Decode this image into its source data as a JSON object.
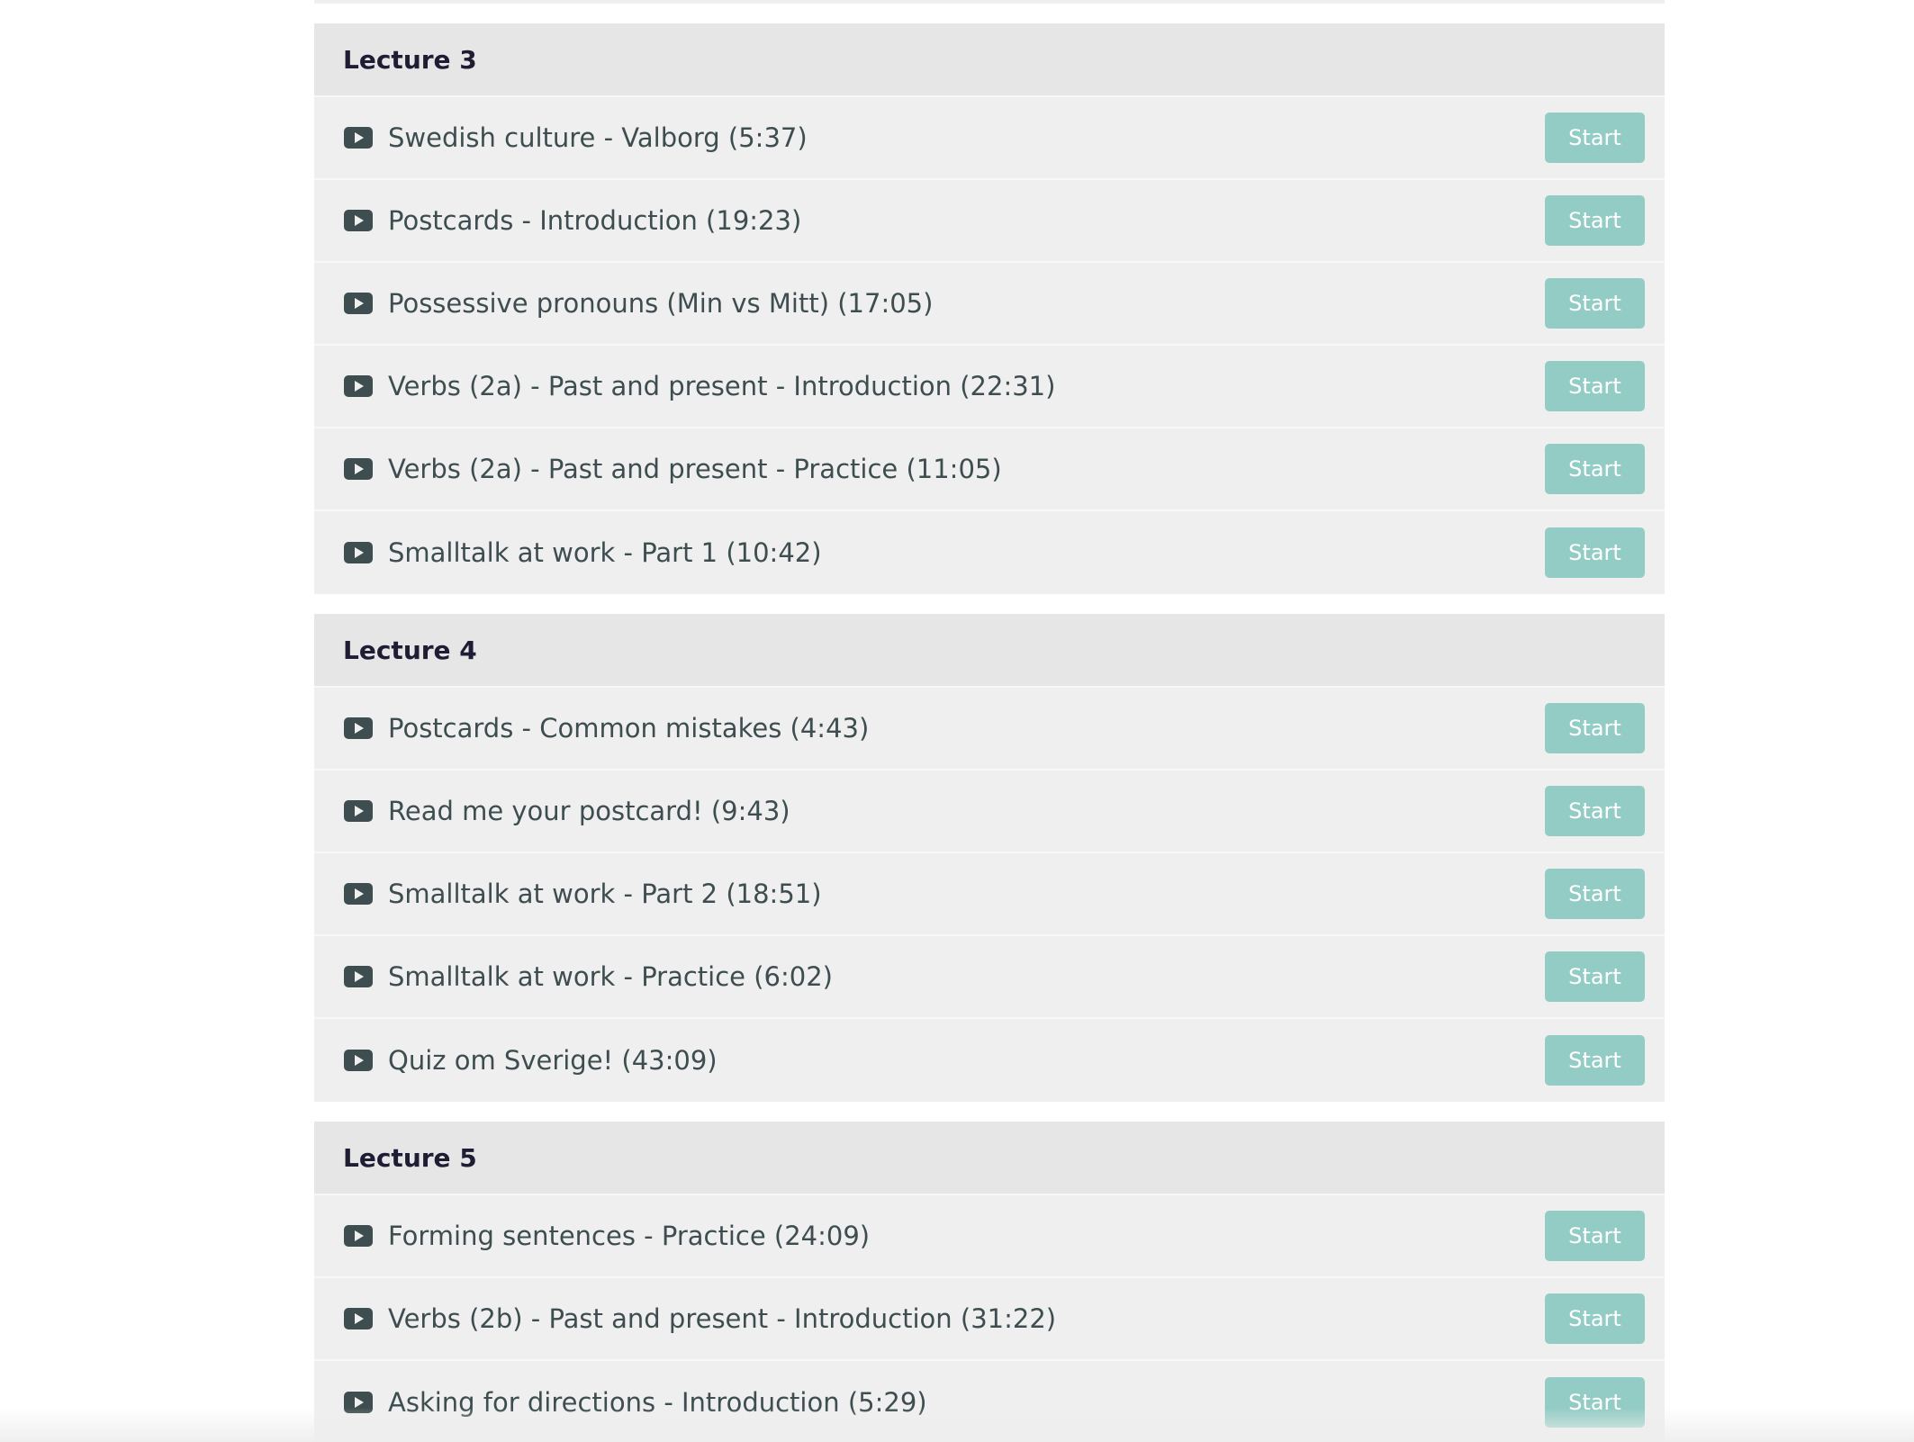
{
  "colors": {
    "accent_button": "#93ccc4",
    "section_header_bg": "#e6e6e7",
    "item_bg": "#efefef",
    "title_text": "#1f1d33",
    "item_text": "#3e4d4f"
  },
  "icons": {
    "item_icon": "play-video-icon"
  },
  "sections": [
    {
      "title": "Lecture 3",
      "items": [
        {
          "title": "Swedish culture - Valborg (5:37)",
          "button": "Start"
        },
        {
          "title": "Postcards - Introduction (19:23)",
          "button": "Start"
        },
        {
          "title": "Possessive pronouns (Min vs Mitt) (17:05)",
          "button": "Start"
        },
        {
          "title": "Verbs (2a) - Past and present - Introduction (22:31)",
          "button": "Start"
        },
        {
          "title": "Verbs (2a) - Past and present - Practice (11:05)",
          "button": "Start"
        },
        {
          "title": "Smalltalk at work - Part 1 (10:42)",
          "button": "Start"
        }
      ]
    },
    {
      "title": "Lecture 4",
      "items": [
        {
          "title": "Postcards - Common mistakes (4:43)",
          "button": "Start"
        },
        {
          "title": "Read me your postcard! (9:43)",
          "button": "Start"
        },
        {
          "title": "Smalltalk at work - Part 2 (18:51)",
          "button": "Start"
        },
        {
          "title": "Smalltalk at work - Practice (6:02)",
          "button": "Start"
        },
        {
          "title": "Quiz om Sverige! (43:09)",
          "button": "Start"
        }
      ]
    },
    {
      "title": "Lecture 5",
      "items": [
        {
          "title": "Forming sentences - Practice (24:09)",
          "button": "Start"
        },
        {
          "title": "Verbs (2b) - Past and present - Introduction (31:22)",
          "button": "Start"
        },
        {
          "title": "Asking for directions - Introduction (5:29)",
          "button": "Start"
        }
      ]
    }
  ]
}
